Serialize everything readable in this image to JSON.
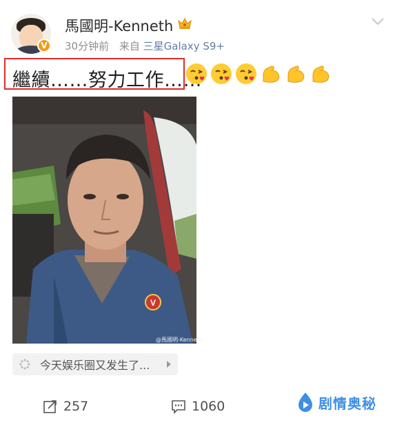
{
  "post": {
    "username": "馬國明-Kenneth",
    "time": "30分钟前",
    "source_prefix": "来自",
    "device": "三星Galaxy S9+",
    "text": "繼續……努力工作……",
    "emojis": [
      "kiss-face-icon",
      "kiss-face-icon",
      "kiss-face-icon",
      "flexed-biceps-icon",
      "flexed-biceps-icon",
      "flexed-biceps-icon"
    ],
    "photo_watermark": "@馬國明-Kenneth",
    "topic_chip": "今天娱乐圈又发生了..."
  },
  "actions": {
    "repost_count": "257",
    "comment_count": "1060"
  },
  "brand": {
    "name": "剧情奥秘"
  },
  "colors": {
    "highlight": "#e02a2a",
    "verified": "#f39c12",
    "link": "#5f7fa6",
    "brand": "#3f8fe6"
  }
}
